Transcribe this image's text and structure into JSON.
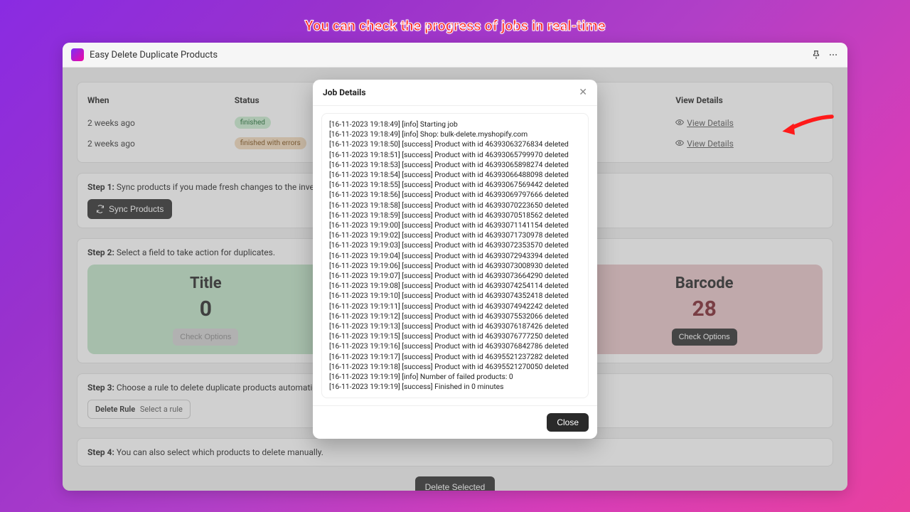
{
  "banner": "You can check the progress of jobs in real-time",
  "app": {
    "title": "Easy Delete Duplicate Products"
  },
  "jobs": {
    "headers": [
      "When",
      "Status",
      "",
      "",
      "View Details"
    ],
    "rows": [
      {
        "when": "2 weeks ago",
        "status": "finished",
        "status_kind": "finished",
        "view": "View Details"
      },
      {
        "when": "2 weeks ago",
        "status": "finished with errors",
        "status_kind": "errors",
        "view": "View Details"
      }
    ]
  },
  "step1": {
    "label_prefix": "Step 1:",
    "label": "Sync products if you made fresh changes to the inventory.",
    "button": "Sync Products"
  },
  "step2": {
    "label_prefix": "Step 2:",
    "label": "Select a field to take action for duplicates.",
    "cards": [
      {
        "title": "Title",
        "value": "0",
        "button": "Check Options",
        "variant": "green",
        "enabled": false
      },
      {
        "title": "",
        "value": "",
        "button": "",
        "variant": "hidden",
        "enabled": false
      },
      {
        "title": "Barcode",
        "value": "28",
        "button": "Check Options",
        "variant": "red",
        "enabled": true
      }
    ]
  },
  "step3": {
    "label_prefix": "Step 3:",
    "label": "Choose a rule to delete duplicate products automatically in bulk.",
    "select_label": "Delete Rule",
    "select_value": "Select a rule"
  },
  "step4": {
    "label_prefix": "Step 4:",
    "label": "You can also select which products to delete manually.",
    "button": "Delete Selected"
  },
  "modal": {
    "title": "Job Details",
    "close": "Close",
    "log_lines": [
      "[16-11-2023 19:18:49] [info] Starting job",
      "[16-11-2023 19:18:49] [info] Shop: bulk-delete.myshopify.com",
      "[16-11-2023 19:18:50] [success] Product with id 46393063276834 deleted",
      "[16-11-2023 19:18:51] [success] Product with id 46393065799970 deleted",
      "[16-11-2023 19:18:53] [success] Product with id 46393065898274 deleted",
      "[16-11-2023 19:18:54] [success] Product with id 46393066488098 deleted",
      "[16-11-2023 19:18:55] [success] Product with id 46393067569442 deleted",
      "[16-11-2023 19:18:56] [success] Product with id 46393069797666 deleted",
      "[16-11-2023 19:18:58] [success] Product with id 46393070223650 deleted",
      "[16-11-2023 19:18:59] [success] Product with id 46393070518562 deleted",
      "[16-11-2023 19:19:00] [success] Product with id 46393071141154 deleted",
      "[16-11-2023 19:19:02] [success] Product with id 46393071730978 deleted",
      "[16-11-2023 19:19:03] [success] Product with id 46393072353570 deleted",
      "[16-11-2023 19:19:04] [success] Product with id 46393072943394 deleted",
      "[16-11-2023 19:19:06] [success] Product with id 46393073008930 deleted",
      "[16-11-2023 19:19:07] [success] Product with id 46393073664290 deleted",
      "[16-11-2023 19:19:08] [success] Product with id 46393074254114 deleted",
      "[16-11-2023 19:19:10] [success] Product with id 46393074352418 deleted",
      "[16-11-2023 19:19:11] [success] Product with id 46393074942242 deleted",
      "[16-11-2023 19:19:12] [success] Product with id 46393075532066 deleted",
      "[16-11-2023 19:19:13] [success] Product with id 46393076187426 deleted",
      "[16-11-2023 19:19:15] [success] Product with id 46393076777250 deleted",
      "[16-11-2023 19:19:16] [success] Product with id 46393076842786 deleted",
      "[16-11-2023 19:19:17] [success] Product with id 46395521237282 deleted",
      "[16-11-2023 19:19:18] [success] Product with id 46395521270050 deleted",
      "[16-11-2023 19:19:19] [info] Number of failed products: 0",
      "[16-11-2023 19:19:19] [success] Finished in 0 minutes"
    ]
  }
}
